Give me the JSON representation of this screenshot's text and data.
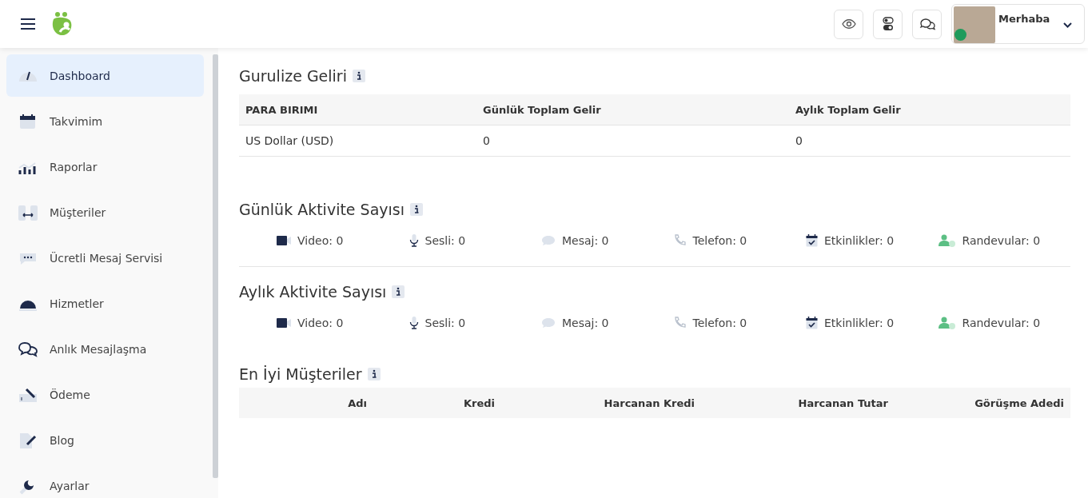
{
  "user": {
    "greeting": "Merhaba",
    "online": true
  },
  "sidebar": {
    "items": [
      {
        "label": "Dashboard",
        "kind": "gauge",
        "selected": true
      },
      {
        "label": "Takvimim",
        "kind": "calendar",
        "selected": false
      },
      {
        "label": "Raporlar",
        "kind": "chart",
        "selected": false
      },
      {
        "label": "Müşteriler",
        "kind": "people",
        "selected": false
      },
      {
        "label": "Ücretli Mesaj Servisi",
        "kind": "dots",
        "selected": false
      },
      {
        "label": "Hizmetler",
        "kind": "bell",
        "selected": false
      },
      {
        "label": "Anlık Mesajlaşma",
        "kind": "chat",
        "selected": false
      },
      {
        "label": "Ödeme",
        "kind": "payment",
        "selected": false
      },
      {
        "label": "Blog",
        "kind": "blog",
        "selected": false
      },
      {
        "label": "Ayarlar",
        "kind": "wrench",
        "selected": false
      }
    ]
  },
  "revenue": {
    "title": "Gurulize Geliri",
    "columns": [
      "PARA BIRIMI",
      "Günlük Toplam Gelir",
      "Aylık Toplam Gelir"
    ],
    "rows": [
      [
        "US Dollar (USD)",
        "0",
        "0"
      ]
    ]
  },
  "daily": {
    "title": "Günlük Aktivite Sayısı",
    "items": [
      {
        "kind": "video",
        "label": "Video: 0"
      },
      {
        "kind": "voice",
        "label": "Sesli: 0"
      },
      {
        "kind": "message",
        "label": "Mesaj: 0"
      },
      {
        "kind": "phone",
        "label": "Telefon: 0"
      },
      {
        "kind": "event",
        "label": "Etkinlikler: 0"
      },
      {
        "kind": "appointment",
        "label": "Randevular: 0"
      }
    ]
  },
  "monthly": {
    "title": "Aylık Aktivite Sayısı",
    "items": [
      {
        "kind": "video",
        "label": "Video: 0"
      },
      {
        "kind": "voice",
        "label": "Sesli: 0"
      },
      {
        "kind": "message",
        "label": "Mesaj: 0"
      },
      {
        "kind": "phone",
        "label": "Telefon: 0"
      },
      {
        "kind": "event",
        "label": "Etkinlikler: 0"
      },
      {
        "kind": "appointment",
        "label": "Randevular: 0"
      }
    ]
  },
  "top_customers": {
    "title": "En İyi Müşteriler",
    "columns": [
      "Adı",
      "Kredi",
      "Harcanan Kredi",
      "Harcanan Tutar",
      "Görüşme Adedi"
    ]
  }
}
